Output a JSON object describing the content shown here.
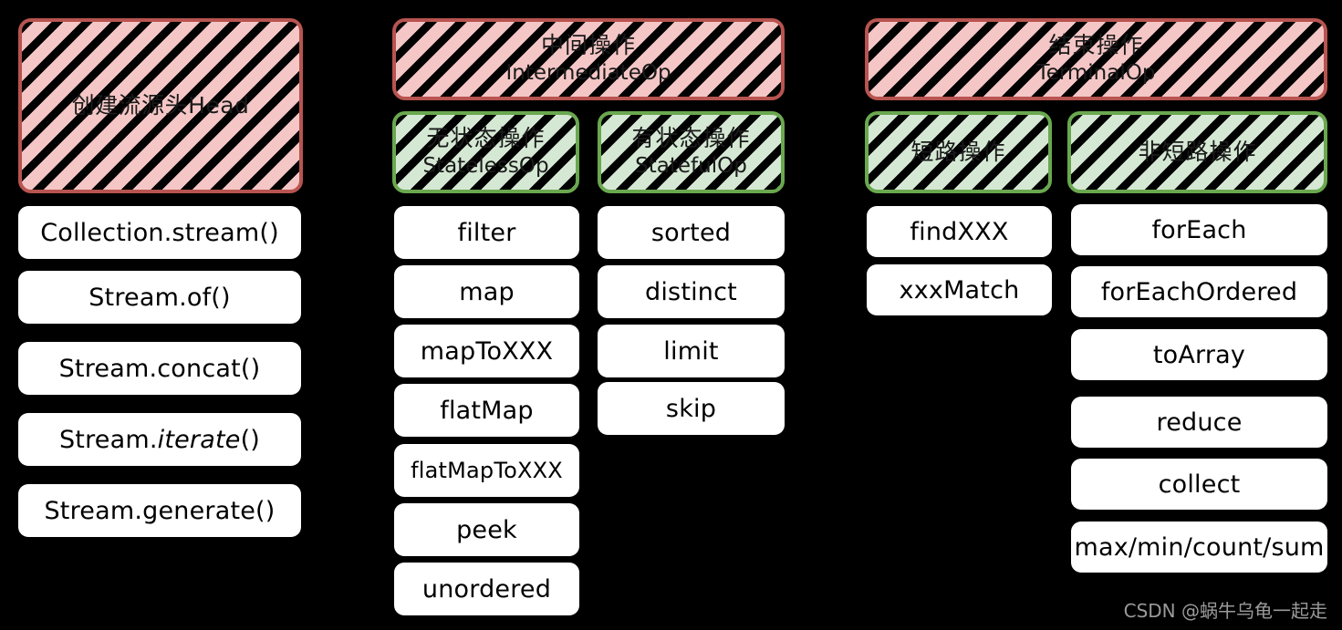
{
  "theme": {
    "background": "#000000",
    "pink_fill": "#f5c6c6",
    "pink_border": "#b85450",
    "green_fill": "#d5e8d4",
    "green_border": "#6aa84f",
    "chip_fill": "#ffffff",
    "text": "#000000",
    "watermark_color": "#9a9a9a"
  },
  "columns": {
    "source": {
      "header": {
        "title_cn": "创建流源头Head",
        "title_en": ""
      },
      "items": [
        {
          "label": "Collection.stream()"
        },
        {
          "label": "Stream.of()"
        },
        {
          "label": "Stream.concat()"
        },
        {
          "label_pre": "Stream.",
          "label_italic": "iterate",
          "label_post": "()"
        },
        {
          "label": "Stream.generate()"
        }
      ]
    },
    "intermediate": {
      "header": {
        "title_cn": "中间操作",
        "title_en": "IntermediateOp"
      },
      "stateless": {
        "header": {
          "title_cn": "无状态操作",
          "title_en": "StatelessOp"
        },
        "items": [
          {
            "label": "filter"
          },
          {
            "label": "map"
          },
          {
            "label": "mapToXXX"
          },
          {
            "label": "flatMap"
          },
          {
            "label": "flatMapToXXX"
          },
          {
            "label": "peek"
          },
          {
            "label": "unordered"
          }
        ]
      },
      "stateful": {
        "header": {
          "title_cn": "有状态操作",
          "title_en": "StatefulOp"
        },
        "items": [
          {
            "label": "sorted"
          },
          {
            "label": "distinct"
          },
          {
            "label": "limit"
          },
          {
            "label": "skip"
          }
        ]
      }
    },
    "terminal": {
      "header": {
        "title_cn": "结束操作",
        "title_en": "TerminalOp"
      },
      "shortcircuit": {
        "header": {
          "title_cn": "短路操作",
          "title_en": ""
        },
        "items": [
          {
            "label": "findXXX"
          },
          {
            "label": "xxxMatch"
          }
        ]
      },
      "nonshortcircuit": {
        "header": {
          "title_cn": "非短路操作",
          "title_en": ""
        },
        "items": [
          {
            "label": "forEach"
          },
          {
            "label": "forEachOrdered"
          },
          {
            "label": "toArray"
          },
          {
            "label": "reduce"
          },
          {
            "label": "collect"
          },
          {
            "label": "max/min/count/sum"
          }
        ]
      }
    }
  },
  "watermark": {
    "text": "CSDN @蜗牛乌龟一起走"
  }
}
